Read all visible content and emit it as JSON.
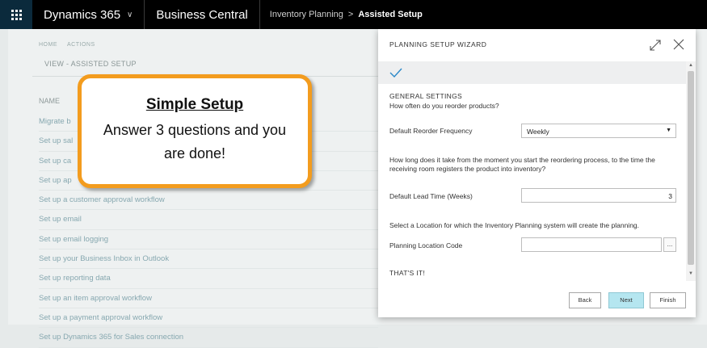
{
  "topbar": {
    "app_name": "Dynamics 365",
    "product": "Business Central",
    "breadcrumb_parent": "Inventory Planning",
    "breadcrumb_current": "Assisted Setup"
  },
  "background": {
    "action_home": "HOME",
    "action_actions": "ACTIONS",
    "view_title": "VIEW - ASSISTED SETUP",
    "name_header": "NAME",
    "items": [
      "Migrate b",
      "Set up sal",
      "Set up ca",
      "Set up ap",
      "Set up a customer approval workflow",
      "Set up email",
      "Set up email logging",
      "Set up your Business Inbox in Outlook",
      "Set up reporting data",
      "Set up an item approval workflow",
      "Set up a payment approval workflow",
      "Set up Dynamics 365 for Sales connection"
    ]
  },
  "callout": {
    "title": "Simple Setup",
    "body": "Answer 3 questions and you are done!",
    "border_color": "#f39c1e"
  },
  "dialog": {
    "title": "PLANNING SETUP WIZARD",
    "section_general": "GENERAL SETTINGS",
    "q1": "How often do you reorder products?",
    "field1_label": "Default Reorder Frequency",
    "field1_value": "Weekly",
    "q2": "How long does it take from the moment you start the reordering process, to the time the receiving room registers the product into inventory?",
    "field2_label": "Default Lead Time (Weeks)",
    "field2_value": "3",
    "q3": "Select a Location for which the Inventory Planning system will create the planning.",
    "field3_label": "Planning Location Code",
    "field3_value": "",
    "lookup_label": "...",
    "section_end": "THAT'S IT!",
    "back_label": "Back",
    "next_label": "Next",
    "finish_label": "Finish",
    "next_color": "#b5e6f0"
  },
  "icons": {
    "waffle": "waffle-icon",
    "expand": "expand-icon",
    "close": "close-icon",
    "check": "check-icon"
  }
}
